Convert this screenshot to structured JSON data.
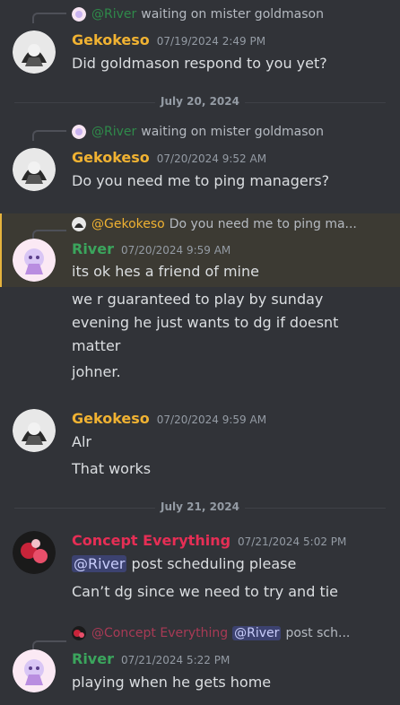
{
  "colors": {
    "background": "#313338",
    "gekokeso": "#f0b232",
    "river": "#3ba55d",
    "concept": "#e62e55",
    "mention_bg": "#3c4270",
    "highlight_bg": "#3c3a33"
  },
  "dividers": [
    "July 20, 2024",
    "July 21, 2024"
  ],
  "messages": [
    {
      "reply": {
        "mention": "@River",
        "text": "waiting on mister goldmason"
      },
      "author": "Gekokeso",
      "timestamp": "07/19/2024 2:49 PM",
      "lines": [
        "Did goldmason respond to you yet?"
      ]
    },
    {
      "reply": {
        "mention": "@River",
        "text": "waiting on mister goldmason"
      },
      "author": "Gekokeso",
      "timestamp": "07/20/2024 9:52 AM",
      "lines": [
        "Do you need me to ping managers?"
      ]
    },
    {
      "reply": {
        "mention": "@Gekokeso",
        "text": "Do you need me to ping ma..."
      },
      "author": "River",
      "timestamp": "07/20/2024 9:59 AM",
      "lines": [
        "its ok hes a friend of mine"
      ]
    },
    {
      "lines": [
        "we r guaranteed to play by sunday evening he just wants to dg if doesnt matter"
      ]
    },
    {
      "lines": [
        "johner."
      ]
    },
    {
      "author": "Gekokeso",
      "timestamp": "07/20/2024 9:59 AM",
      "lines": [
        "Alr"
      ]
    },
    {
      "lines": [
        "That works"
      ]
    },
    {
      "author": "Concept Everything",
      "timestamp": "07/21/2024 5:02 PM",
      "mention": "@River",
      "lines": [
        "post scheduling please"
      ]
    },
    {
      "lines": [
        "Can’t dg since we need to try and tie"
      ]
    },
    {
      "reply": {
        "mention": "@Concept Everything",
        "inner_mention": "@River",
        "text": "post sch..."
      },
      "author": "River",
      "timestamp": "07/21/2024 5:22 PM",
      "lines": [
        "playing when he gets home"
      ]
    }
  ]
}
